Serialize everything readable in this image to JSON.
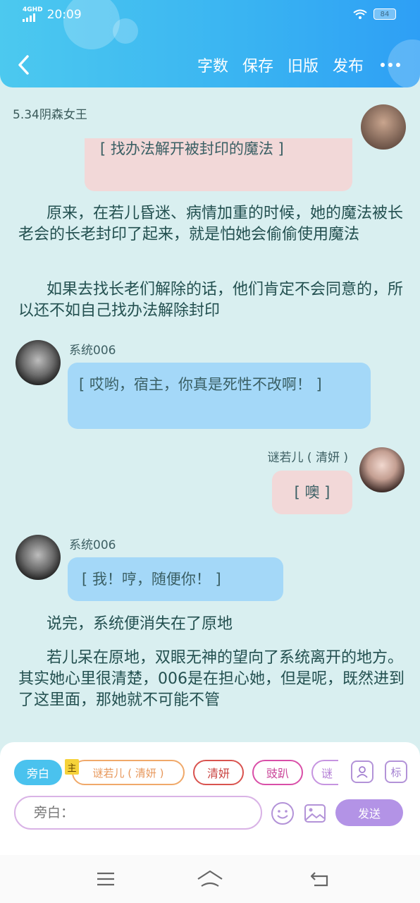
{
  "status_bar": {
    "network": "4GHD",
    "time": "20:09",
    "battery": "84"
  },
  "header": {
    "menu": [
      "字数",
      "保存",
      "旧版",
      "发布"
    ]
  },
  "chapter_title": "5.34阴森女王",
  "messages": {
    "top_bubble": "[ 找办法解开被封印的魔法 ]",
    "narr1": "原来，在若儿昏迷、病情加重的时候，她的魔法被长老会的长老封印了起来，就是怕她会偷偷使用魔法",
    "narr2": "如果去找长老们解除的话，他们肯定不会同意的，所以还不如自己找办法解除封印",
    "msg1_name": "系统006",
    "msg1_text": "[ 哎哟，宿主，你真是死性不改啊！ ]",
    "msg2_name": "谜若儿 ( 清妍 )",
    "msg2_text": "[ 噢 ]",
    "msg3_name": "系统006",
    "msg3_text": "[ 我！哼，随便你！ ]",
    "narr3": "说完，系统便消失在了原地",
    "narr4": "若儿呆在原地，双眼无神的望向了系统离开的地方。其实她心里很清楚，006是在担心她，但是呢，既然进到了这里面，那她就不可能不管"
  },
  "composer": {
    "chips": [
      "旁白",
      "谜若儿 ( 清妍 )",
      "清妍",
      "豉趴",
      "谜"
    ],
    "main_badge": "主",
    "tag_button": "标",
    "input_placeholder": "旁白：",
    "send_label": "发送"
  },
  "colors": {
    "header_start": "#4cc9ef",
    "header_end": "#2e9ff5",
    "page_bg": "#d9eff0",
    "pink_bubble": "#f2d8d8",
    "blue_bubble": "#a4d8f8",
    "send_button": "#b393e6"
  }
}
